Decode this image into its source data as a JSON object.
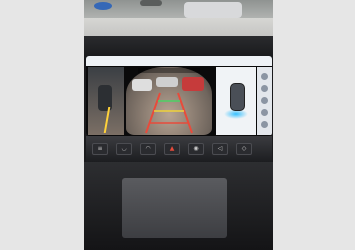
{
  "screen": {
    "status_left": "",
    "status_right": "",
    "camera_title": ""
  },
  "buttons": {
    "hazard": "▲"
  }
}
